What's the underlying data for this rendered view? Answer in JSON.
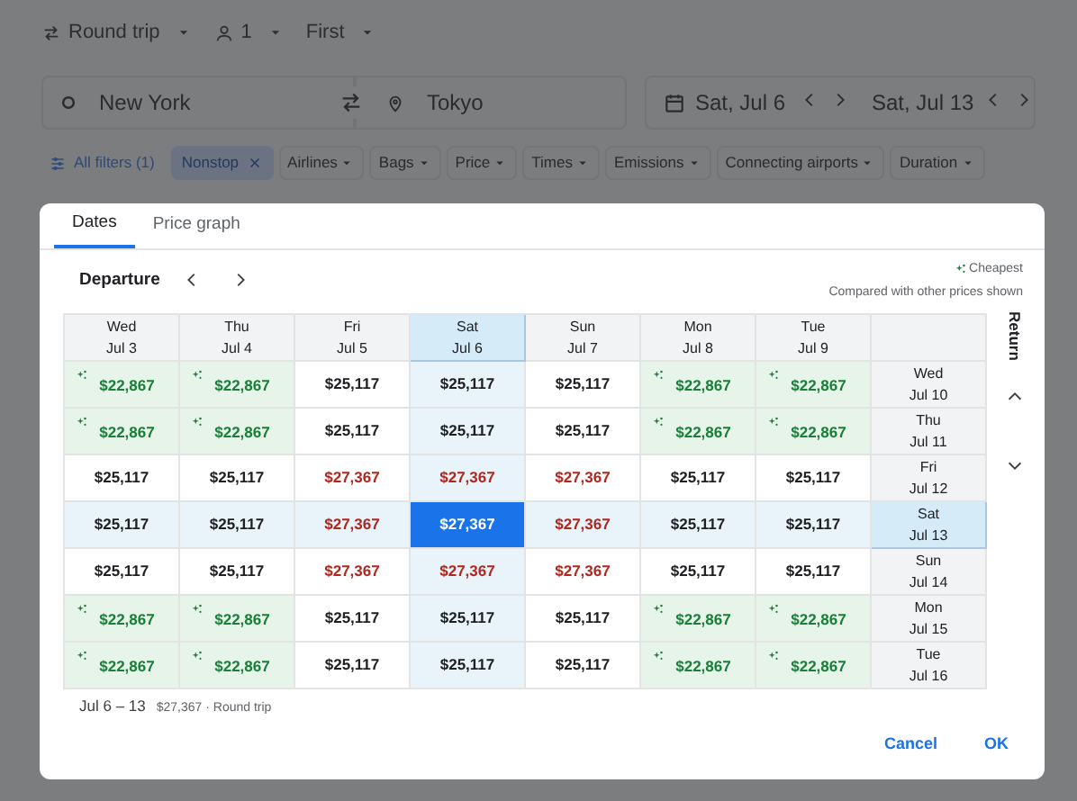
{
  "trip_options": [
    {
      "label": "Round trip",
      "kind": "trip"
    },
    {
      "label": "1",
      "kind": "passengers"
    },
    {
      "label": "First",
      "kind": "class"
    }
  ],
  "origin": "New York",
  "destination": "Tokyo",
  "depart_date": "Sat, Jul 6",
  "return_date": "Sat, Jul 13",
  "filters": [
    {
      "label": "All filters (1)",
      "kind": "all"
    },
    {
      "label": "Nonstop",
      "kind": "active"
    },
    {
      "label": "Airlines",
      "kind": "menu"
    },
    {
      "label": "Bags",
      "kind": "menu"
    },
    {
      "label": "Price",
      "kind": "menu"
    },
    {
      "label": "Times",
      "kind": "menu"
    },
    {
      "label": "Emissions",
      "kind": "menu"
    },
    {
      "label": "Connecting airports",
      "kind": "menu"
    },
    {
      "label": "Duration",
      "kind": "menu"
    }
  ],
  "dialog": {
    "tabs": [
      {
        "label": "Dates",
        "selected": true
      },
      {
        "label": "Price graph",
        "selected": false
      }
    ],
    "departure_label": "Departure",
    "legend": "Cheapest",
    "legend_note": "Compared with other prices shown",
    "return_label": "Return",
    "columns": [
      {
        "day": "Wed",
        "date": "Jul 3",
        "selected": false
      },
      {
        "day": "Thu",
        "date": "Jul 4",
        "selected": false
      },
      {
        "day": "Fri",
        "date": "Jul 5",
        "selected": false
      },
      {
        "day": "Sat",
        "date": "Jul 6",
        "selected": true
      },
      {
        "day": "Sun",
        "date": "Jul 7",
        "selected": false
      },
      {
        "day": "Mon",
        "date": "Jul 8",
        "selected": false
      },
      {
        "day": "Tue",
        "date": "Jul 9",
        "selected": false
      }
    ],
    "rows": [
      {
        "day": "Wed",
        "date": "Jul 10",
        "selected": false,
        "cells": [
          {
            "price": "$22,867",
            "kind": "cheapest",
            "selected": false
          },
          {
            "price": "$22,867",
            "kind": "cheapest",
            "selected": false
          },
          {
            "price": "$25,117",
            "kind": "normal",
            "selected": false
          },
          {
            "price": "$25,117",
            "kind": "normal",
            "selected": false
          },
          {
            "price": "$25,117",
            "kind": "normal",
            "selected": false
          },
          {
            "price": "$22,867",
            "kind": "cheapest",
            "selected": false
          },
          {
            "price": "$22,867",
            "kind": "cheapest",
            "selected": false
          }
        ]
      },
      {
        "day": "Thu",
        "date": "Jul 11",
        "selected": false,
        "cells": [
          {
            "price": "$22,867",
            "kind": "cheapest",
            "selected": false
          },
          {
            "price": "$22,867",
            "kind": "cheapest",
            "selected": false
          },
          {
            "price": "$25,117",
            "kind": "normal",
            "selected": false
          },
          {
            "price": "$25,117",
            "kind": "normal",
            "selected": false
          },
          {
            "price": "$25,117",
            "kind": "normal",
            "selected": false
          },
          {
            "price": "$22,867",
            "kind": "cheapest",
            "selected": false
          },
          {
            "price": "$22,867",
            "kind": "cheapest",
            "selected": false
          }
        ]
      },
      {
        "day": "Fri",
        "date": "Jul 12",
        "selected": false,
        "cells": [
          {
            "price": "$25,117",
            "kind": "normal",
            "selected": false
          },
          {
            "price": "$25,117",
            "kind": "normal",
            "selected": false
          },
          {
            "price": "$27,367",
            "kind": "high",
            "selected": false
          },
          {
            "price": "$27,367",
            "kind": "high",
            "selected": false
          },
          {
            "price": "$27,367",
            "kind": "high",
            "selected": false
          },
          {
            "price": "$25,117",
            "kind": "normal",
            "selected": false
          },
          {
            "price": "$25,117",
            "kind": "normal",
            "selected": false
          }
        ]
      },
      {
        "day": "Sat",
        "date": "Jul 13",
        "selected": true,
        "cells": [
          {
            "price": "$25,117",
            "kind": "normal",
            "selected": false
          },
          {
            "price": "$25,117",
            "kind": "normal",
            "selected": false
          },
          {
            "price": "$27,367",
            "kind": "high",
            "selected": false
          },
          {
            "price": "$27,367",
            "kind": "high",
            "selected": true
          },
          {
            "price": "$27,367",
            "kind": "high",
            "selected": false
          },
          {
            "price": "$25,117",
            "kind": "normal",
            "selected": false
          },
          {
            "price": "$25,117",
            "kind": "normal",
            "selected": false
          }
        ]
      },
      {
        "day": "Sun",
        "date": "Jul 14",
        "selected": false,
        "cells": [
          {
            "price": "$25,117",
            "kind": "normal",
            "selected": false
          },
          {
            "price": "$25,117",
            "kind": "normal",
            "selected": false
          },
          {
            "price": "$27,367",
            "kind": "high",
            "selected": false
          },
          {
            "price": "$27,367",
            "kind": "high",
            "selected": false
          },
          {
            "price": "$27,367",
            "kind": "high",
            "selected": false
          },
          {
            "price": "$25,117",
            "kind": "normal",
            "selected": false
          },
          {
            "price": "$25,117",
            "kind": "normal",
            "selected": false
          }
        ]
      },
      {
        "day": "Mon",
        "date": "Jul 15",
        "selected": false,
        "cells": [
          {
            "price": "$22,867",
            "kind": "cheapest",
            "selected": false
          },
          {
            "price": "$22,867",
            "kind": "cheapest",
            "selected": false
          },
          {
            "price": "$25,117",
            "kind": "normal",
            "selected": false
          },
          {
            "price": "$25,117",
            "kind": "normal",
            "selected": false
          },
          {
            "price": "$25,117",
            "kind": "normal",
            "selected": false
          },
          {
            "price": "$22,867",
            "kind": "cheapest",
            "selected": false
          },
          {
            "price": "$22,867",
            "kind": "cheapest",
            "selected": false
          }
        ]
      },
      {
        "day": "Tue",
        "date": "Jul 16",
        "selected": false,
        "cells": [
          {
            "price": "$22,867",
            "kind": "cheapest",
            "selected": false
          },
          {
            "price": "$22,867",
            "kind": "cheapest",
            "selected": false
          },
          {
            "price": "$25,117",
            "kind": "normal",
            "selected": false
          },
          {
            "price": "$25,117",
            "kind": "normal",
            "selected": false
          },
          {
            "price": "$25,117",
            "kind": "normal",
            "selected": false
          },
          {
            "price": "$22,867",
            "kind": "cheapest",
            "selected": false
          },
          {
            "price": "$22,867",
            "kind": "cheapest",
            "selected": false
          }
        ]
      }
    ],
    "summary_dates": "Jul 6 – 13",
    "summary_price": "$27,367 · Round trip",
    "buttons": [
      "Cancel",
      "OK"
    ]
  }
}
